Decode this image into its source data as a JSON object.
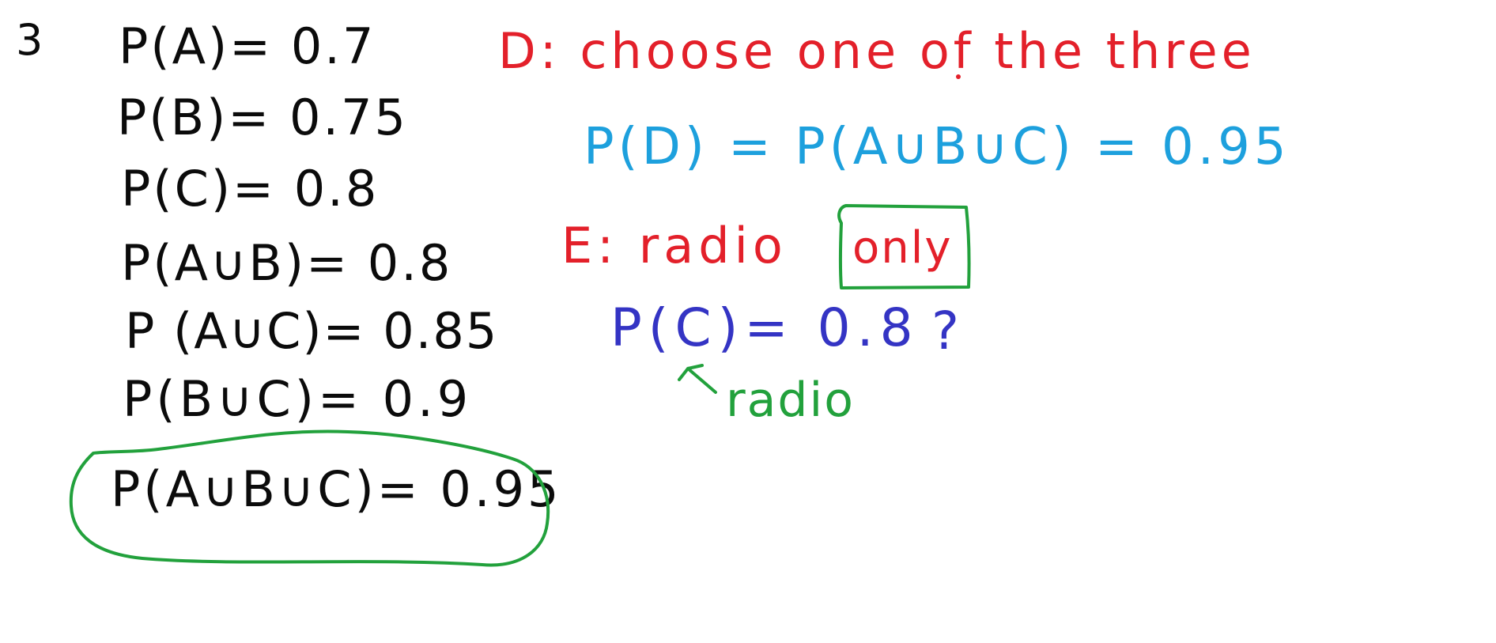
{
  "problem_number": "3",
  "given_probabilities": [
    "P(A)= 0.7",
    "P(B)= 0.75",
    "P(C)= 0.8",
    "P(A∪B)= 0.8",
    "P (A∪C)= 0.85",
    "P(B∪C)= 0.9",
    "P(A∪B∪C)= 0.95"
  ],
  "event_d": "D: choose one of the three",
  "prob_d": "P(D) = P(A∪B∪C) = 0.95",
  "event_e_prefix": "E: radio",
  "event_e_only": "only",
  "prob_c": "P(C)= 0.8",
  "question_mark": "?",
  "radio_label": "radio",
  "colors": {
    "black": "#0b0b0b",
    "red": "#e3202a",
    "cyan": "#1da0dd",
    "blue": "#3434c4",
    "green": "#22a13c"
  }
}
